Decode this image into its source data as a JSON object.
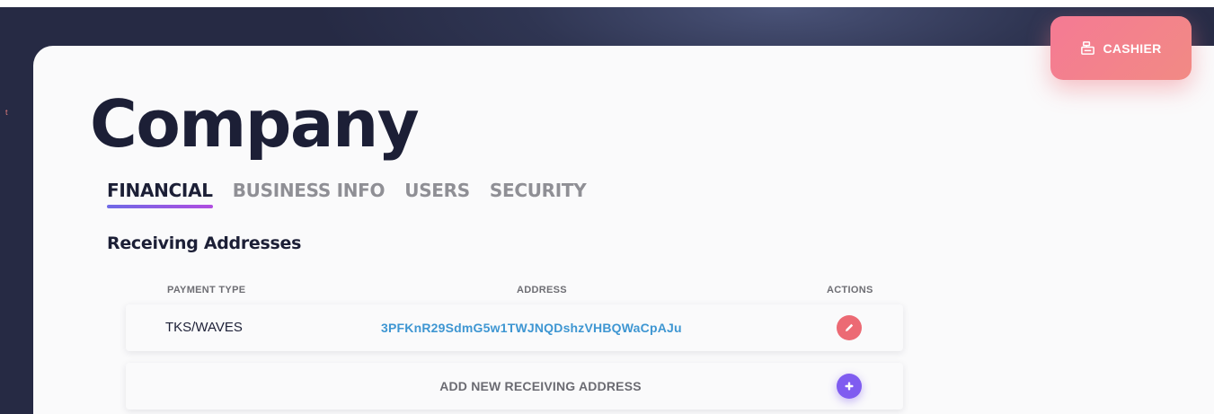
{
  "header": {
    "cashier_label": "CASHIER",
    "cashier_icon": "cash-register-icon"
  },
  "page": {
    "title": "Company",
    "edge_glyph": "t"
  },
  "tabs": [
    {
      "label": "FINANCIAL",
      "active": true
    },
    {
      "label": "BUSINESS INFO",
      "active": false
    },
    {
      "label": "USERS",
      "active": false
    },
    {
      "label": "SECURITY",
      "active": false
    }
  ],
  "section": {
    "title": "Receiving Addresses"
  },
  "table": {
    "columns": {
      "payment_type": "PAYMENT TYPE",
      "address": "ADDRESS",
      "actions": "ACTIONS"
    },
    "rows": [
      {
        "payment_type": "TKS/WAVES",
        "address": "3PFKnR29SdmG5w1TWJNQDshzVHBQWaCpAJu",
        "action_icon": "pencil-icon"
      }
    ],
    "add_row": {
      "label": "ADD NEW RECEIVING ADDRESS",
      "action_icon": "plus-icon"
    }
  },
  "colors": {
    "accent_gradient_start": "#6f6ae6",
    "accent_gradient_end": "#b04de0",
    "cashier_button": "#f47a94",
    "edit_button": "#ec6a74",
    "add_button": "#7f5cf0",
    "address_link": "#3e96d2",
    "title": "#1c1f36",
    "sidebar_bg": "#262a44"
  }
}
